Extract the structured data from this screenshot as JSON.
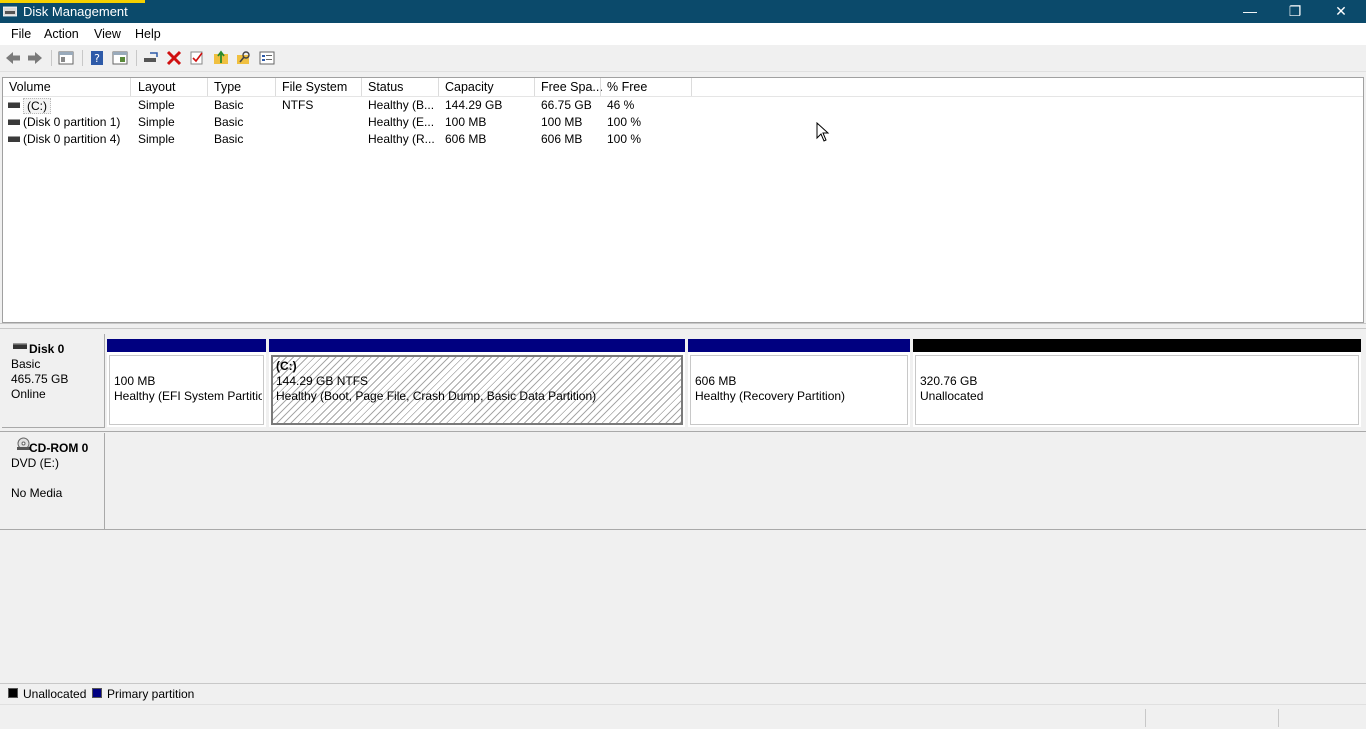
{
  "window": {
    "title": "Disk Management"
  },
  "menu": [
    "File",
    "Action",
    "View",
    "Help"
  ],
  "toolbar": [
    "back-arrow-icon",
    "forward-arrow-icon",
    "console-tree-icon",
    "help-icon",
    "properties-icon",
    "connect-disk-icon",
    "delete-icon",
    "check-icon",
    "up-folder-icon",
    "search-folder-icon",
    "settings-list-icon"
  ],
  "volume_table": {
    "columns": [
      "Volume",
      "Layout",
      "Type",
      "File System",
      "Status",
      "Capacity",
      "Free Spa...",
      "% Free"
    ],
    "rows": [
      [
        "(C:)",
        "Simple",
        "Basic",
        "NTFS",
        "Healthy (B...",
        "144.29 GB",
        "66.75 GB",
        "46 %"
      ],
      [
        "(Disk 0 partition 1)",
        "Simple",
        "Basic",
        "",
        "Healthy (E...",
        "100 MB",
        "100 MB",
        "100 %"
      ],
      [
        "(Disk 0 partition 4)",
        "Simple",
        "Basic",
        "",
        "Healthy (R...",
        "606 MB",
        "606 MB",
        "100 %"
      ]
    ]
  },
  "disks": [
    {
      "name": "Disk 0",
      "type": "Basic",
      "size": "465.75 GB",
      "state": "Online",
      "partitions": [
        {
          "label": "",
          "size": "100 MB",
          "status": "Healthy (EFI System Partitio",
          "kind": "primary"
        },
        {
          "label": "(C:)",
          "size": "144.29 GB NTFS",
          "status": "Healthy (Boot, Page File, Crash Dump, Basic Data Partition)",
          "kind": "primary-selected"
        },
        {
          "label": "",
          "size": "606 MB",
          "status": "Healthy (Recovery Partition)",
          "kind": "primary"
        },
        {
          "label": "",
          "size": "320.76 GB",
          "status": "Unallocated",
          "kind": "unallocated"
        }
      ]
    },
    {
      "name": "CD-ROM 0",
      "type": "DVD (E:)",
      "state": "No Media"
    }
  ],
  "legend": [
    {
      "label": "Unallocated",
      "color": "#000000"
    },
    {
      "label": "Primary partition",
      "color": "#000080"
    }
  ],
  "colors": {
    "titlebar": "#0b4a6b",
    "primary": "#000080",
    "unallocated": "#000000"
  }
}
